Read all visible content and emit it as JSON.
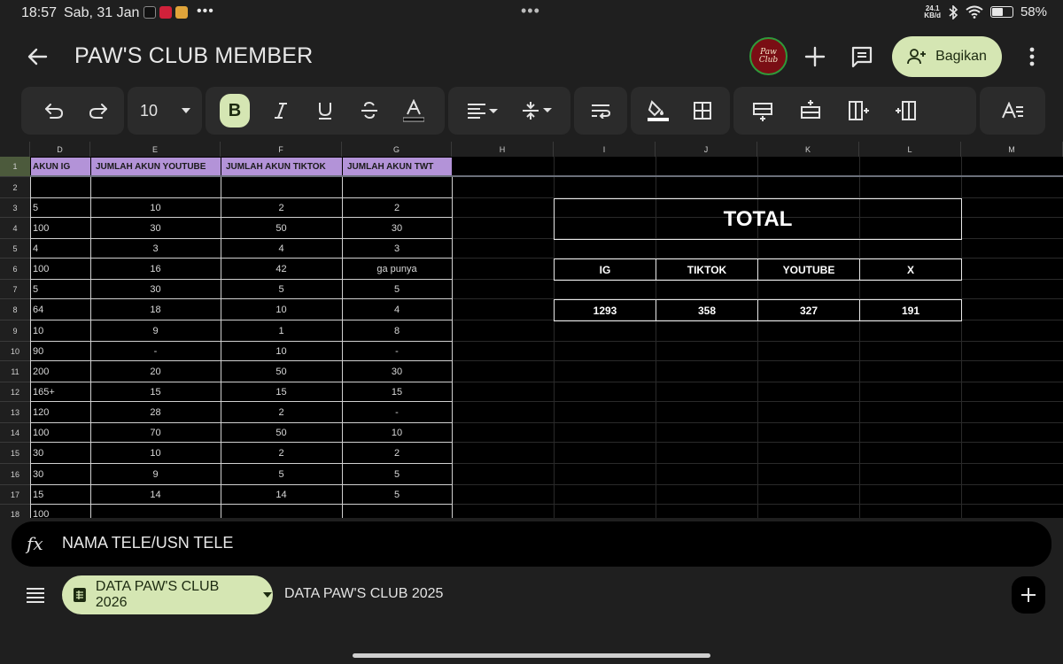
{
  "status": {
    "time": "18:57",
    "date": "Sab, 31 Jan",
    "net_speed_top": "24.1",
    "net_speed_bottom": "KB/d",
    "battery": "58%",
    "battery_level": 0.58
  },
  "title_bar": {
    "title": "PAW'S CLUB MEMBER",
    "logo_text": "Paw Club",
    "share_label": "Bagikan"
  },
  "toolbar": {
    "font_size": "10",
    "bold_label": "B"
  },
  "columns": [
    {
      "label": "D"
    },
    {
      "label": "E"
    },
    {
      "label": "F"
    },
    {
      "label": "G"
    },
    {
      "label": "H"
    },
    {
      "label": "I"
    },
    {
      "label": "J"
    },
    {
      "label": "K"
    },
    {
      "label": "L"
    },
    {
      "label": "M"
    }
  ],
  "headers": {
    "d": "AKUN IG",
    "e": "JUMLAH AKUN YOUTUBE",
    "f": "JUMLAH AKUN TIKTOK",
    "g": "JUMLAH AKUN TWT"
  },
  "rows": [
    {
      "n": "1"
    },
    {
      "n": "2",
      "d": "",
      "e": "",
      "f": "",
      "g": ""
    },
    {
      "n": "3",
      "d": "5",
      "e": "10",
      "f": "2",
      "g": "2"
    },
    {
      "n": "4",
      "d": "100",
      "e": "30",
      "f": "50",
      "g": "30"
    },
    {
      "n": "5",
      "d": "4",
      "e": "3",
      "f": "4",
      "g": "3"
    },
    {
      "n": "6",
      "d": "100",
      "e": "16",
      "f": "42",
      "g": "ga punya"
    },
    {
      "n": "7",
      "d": "5",
      "e": "30",
      "f": "5",
      "g": "5"
    },
    {
      "n": "8",
      "d": "64",
      "e": "18",
      "f": "10",
      "g": "4"
    },
    {
      "n": "9",
      "d": "10",
      "e": "9",
      "f": "1",
      "g": "8"
    },
    {
      "n": "10",
      "d": "90",
      "e": "-",
      "f": "10",
      "g": "-"
    },
    {
      "n": "11",
      "d": "200",
      "e": "20",
      "f": "50",
      "g": "30"
    },
    {
      "n": "12",
      "d": "165+",
      "e": "15",
      "f": "15",
      "g": "15"
    },
    {
      "n": "13",
      "d": "120",
      "e": "28",
      "f": "2",
      "g": "-"
    },
    {
      "n": "14",
      "d": "100",
      "e": "70",
      "f": "50",
      "g": "10"
    },
    {
      "n": "15",
      "d": "30",
      "e": "10",
      "f": "2",
      "g": "2"
    },
    {
      "n": "16",
      "d": "30",
      "e": "9",
      "f": "5",
      "g": "5"
    },
    {
      "n": "17",
      "d": "15",
      "e": "14",
      "f": "14",
      "g": "5"
    },
    {
      "n": "18",
      "d": "100",
      "e": "",
      "f": "",
      "g": ""
    }
  ],
  "totals": {
    "title": "TOTAL",
    "labels": [
      "IG",
      "TIKTOK",
      "YOUTUBE",
      "X"
    ],
    "values": [
      "1293",
      "358",
      "327",
      "191"
    ]
  },
  "formula_bar": {
    "fx": "fx",
    "content": "NAMA TELE/USN TELE"
  },
  "sheet_tabs": {
    "active": "DATA PAW'S CLUB 2026",
    "inactive": "DATA PAW'S CLUB 2025"
  },
  "colors": {
    "header_purple": "#b393d8",
    "accent_green": "#d5e6b3",
    "background": "#1f1f1f"
  }
}
